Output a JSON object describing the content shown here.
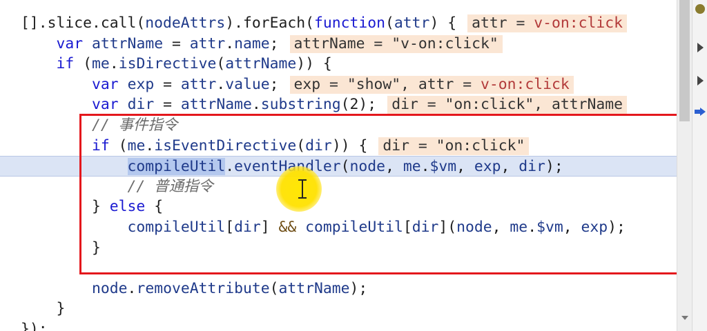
{
  "code_lines": [
    {
      "segments": [
        {
          "t": "[].slice.call(",
          "c": "p"
        },
        {
          "t": "nodeAttrs",
          "c": "id"
        },
        {
          "t": ").forEach(",
          "c": "p"
        },
        {
          "t": "function",
          "c": "kw"
        },
        {
          "t": "(",
          "c": "p"
        },
        {
          "t": "attr",
          "c": "id"
        },
        {
          "t": ") {",
          "c": "p"
        }
      ],
      "hint": [
        {
          "t": "attr = ",
          "c": "p"
        },
        {
          "t": "v-on:click",
          "c": "red"
        }
      ]
    },
    {
      "segments": [
        {
          "t": "    ",
          "c": "p"
        },
        {
          "t": "var",
          "c": "kw"
        },
        {
          "t": " ",
          "c": "p"
        },
        {
          "t": "attrName",
          "c": "id"
        },
        {
          "t": " = ",
          "c": "p"
        },
        {
          "t": "attr",
          "c": "id"
        },
        {
          "t": ".",
          "c": "p"
        },
        {
          "t": "name",
          "c": "id"
        },
        {
          "t": ";",
          "c": "p"
        }
      ],
      "hint": [
        {
          "t": "attrName = \"v-on:click\"",
          "c": "p"
        }
      ]
    },
    {
      "segments": [
        {
          "t": "    ",
          "c": "p"
        },
        {
          "t": "if",
          "c": "kw"
        },
        {
          "t": " (",
          "c": "p"
        },
        {
          "t": "me",
          "c": "id"
        },
        {
          "t": ".",
          "c": "p"
        },
        {
          "t": "isDirective",
          "c": "id"
        },
        {
          "t": "(",
          "c": "p"
        },
        {
          "t": "attrName",
          "c": "id"
        },
        {
          "t": ")) {",
          "c": "p"
        }
      ],
      "hint": []
    },
    {
      "segments": [
        {
          "t": "        ",
          "c": "p"
        },
        {
          "t": "var",
          "c": "kw"
        },
        {
          "t": " ",
          "c": "p"
        },
        {
          "t": "exp",
          "c": "id"
        },
        {
          "t": " = ",
          "c": "p"
        },
        {
          "t": "attr",
          "c": "id"
        },
        {
          "t": ".",
          "c": "p"
        },
        {
          "t": "value",
          "c": "id"
        },
        {
          "t": ";",
          "c": "p"
        }
      ],
      "hint": [
        {
          "t": "exp = \"show\", attr = ",
          "c": "p"
        },
        {
          "t": "v-on:click",
          "c": "red"
        }
      ]
    },
    {
      "segments": [
        {
          "t": "        ",
          "c": "p"
        },
        {
          "t": "var",
          "c": "kw"
        },
        {
          "t": " ",
          "c": "p"
        },
        {
          "t": "dir",
          "c": "id"
        },
        {
          "t": " = ",
          "c": "p"
        },
        {
          "t": "attrName",
          "c": "id"
        },
        {
          "t": ".",
          "c": "p"
        },
        {
          "t": "substring",
          "c": "id"
        },
        {
          "t": "(2);",
          "c": "p"
        }
      ],
      "hint": [
        {
          "t": "dir = \"on:click\", attrName",
          "c": "p"
        }
      ]
    },
    {
      "segments": [
        {
          "t": "        ",
          "c": "p"
        },
        {
          "t": "// 事件指令",
          "c": "cm"
        }
      ],
      "hint": []
    },
    {
      "segments": [
        {
          "t": "        ",
          "c": "p"
        },
        {
          "t": "if",
          "c": "kw"
        },
        {
          "t": " (",
          "c": "p"
        },
        {
          "t": "me",
          "c": "id"
        },
        {
          "t": ".",
          "c": "p"
        },
        {
          "t": "isEventDirective",
          "c": "id"
        },
        {
          "t": "(",
          "c": "p"
        },
        {
          "t": "dir",
          "c": "id"
        },
        {
          "t": ")) {",
          "c": "p"
        }
      ],
      "hint": [
        {
          "t": "dir = \"on:click\"",
          "c": "p"
        }
      ]
    },
    {
      "segments": [
        {
          "t": "            ",
          "c": "p"
        },
        {
          "t": "compileUtil",
          "c": "sel"
        },
        {
          "t": ".",
          "c": "p"
        },
        {
          "t": "eventHandler",
          "c": "id"
        },
        {
          "t": "(",
          "c": "p"
        },
        {
          "t": "node",
          "c": "id"
        },
        {
          "t": ", ",
          "c": "p"
        },
        {
          "t": "me",
          "c": "id"
        },
        {
          "t": ".",
          "c": "p"
        },
        {
          "t": "$vm",
          "c": "id"
        },
        {
          "t": ", ",
          "c": "p"
        },
        {
          "t": "exp",
          "c": "id"
        },
        {
          "t": ", ",
          "c": "p"
        },
        {
          "t": "dir",
          "c": "id"
        },
        {
          "t": ");",
          "c": "p"
        }
      ],
      "hint": [],
      "current": true
    },
    {
      "segments": [
        {
          "t": "            ",
          "c": "p"
        },
        {
          "t": "// 普通指令",
          "c": "cm"
        }
      ],
      "hint": []
    },
    {
      "segments": [
        {
          "t": "        } ",
          "c": "p"
        },
        {
          "t": "else",
          "c": "kw"
        },
        {
          "t": " {",
          "c": "p"
        }
      ],
      "hint": []
    },
    {
      "segments": [
        {
          "t": "            ",
          "c": "p"
        },
        {
          "t": "compileUtil",
          "c": "id"
        },
        {
          "t": "[",
          "c": "p"
        },
        {
          "t": "dir",
          "c": "id"
        },
        {
          "t": "] ",
          "c": "p"
        },
        {
          "t": "&&",
          "c": "op"
        },
        {
          "t": " ",
          "c": "p"
        },
        {
          "t": "compileUtil",
          "c": "id"
        },
        {
          "t": "[",
          "c": "p"
        },
        {
          "t": "dir",
          "c": "id"
        },
        {
          "t": "](",
          "c": "p"
        },
        {
          "t": "node",
          "c": "id"
        },
        {
          "t": ", ",
          "c": "p"
        },
        {
          "t": "me",
          "c": "id"
        },
        {
          "t": ".",
          "c": "p"
        },
        {
          "t": "$vm",
          "c": "id"
        },
        {
          "t": ", ",
          "c": "p"
        },
        {
          "t": "exp",
          "c": "id"
        },
        {
          "t": ");",
          "c": "p"
        }
      ],
      "hint": []
    },
    {
      "segments": [
        {
          "t": "        }",
          "c": "p"
        }
      ],
      "hint": []
    },
    {
      "segments": [
        {
          "t": "",
          "c": "p"
        }
      ],
      "hint": []
    },
    {
      "segments": [
        {
          "t": "        ",
          "c": "p"
        },
        {
          "t": "node",
          "c": "id"
        },
        {
          "t": ".",
          "c": "p"
        },
        {
          "t": "removeAttribute",
          "c": "id"
        },
        {
          "t": "(",
          "c": "p"
        },
        {
          "t": "attrName",
          "c": "id"
        },
        {
          "t": ");",
          "c": "p"
        }
      ],
      "hint": []
    },
    {
      "segments": [
        {
          "t": "    }",
          "c": "p"
        }
      ],
      "hint": []
    },
    {
      "segments": [
        {
          "t": "});",
          "c": "p"
        }
      ],
      "hint": []
    }
  ],
  "colors": {
    "keyword": "#1a1ad1",
    "identifier": "#1f3a8a",
    "comment": "#6b6b6b",
    "hint_bg": "#fbe6d4",
    "highlight_box": "#e4171c",
    "current_line_bg": "#dbe4f5",
    "cursor_dot": "#ffe600"
  },
  "icons": {
    "right_panel": [
      "warning-icon",
      "resume-icon",
      "step-over-icon",
      "current-frame-icon"
    ],
    "scroll_down": "chevron-down-icon"
  }
}
